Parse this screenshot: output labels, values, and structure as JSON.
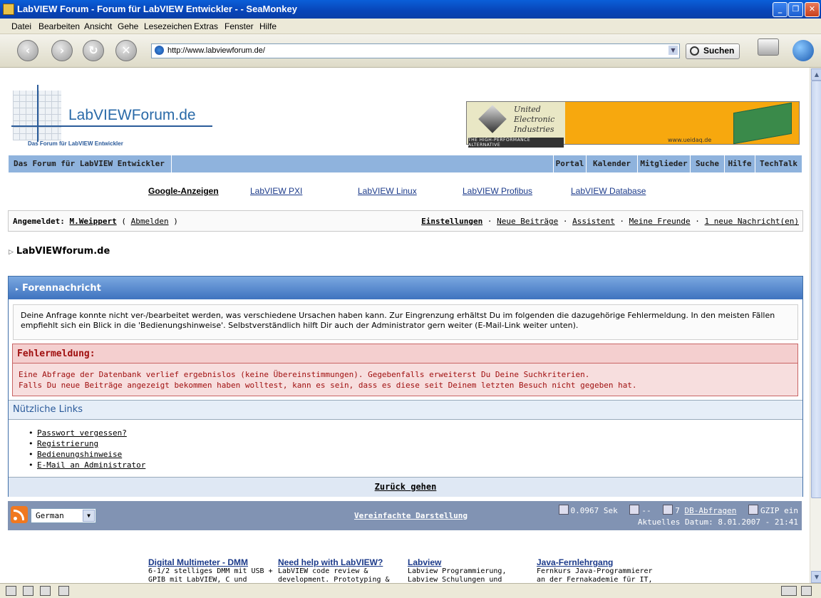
{
  "window": {
    "title": "LabVIEW Forum - Forum für LabVIEW Entwickler - - SeaMonkey"
  },
  "menu": [
    "Datei",
    "Bearbeiten",
    "Ansicht",
    "Gehe",
    "Lesezeichen",
    "Extras",
    "Fenster",
    "Hilfe"
  ],
  "toolbar": {
    "url": "http://www.labviewforum.de/",
    "search_label": "Suchen"
  },
  "logo": {
    "text": "LabVIEWForum.de",
    "subtitle": "Das Forum für LabVIEW Entwickler"
  },
  "banner": {
    "brand": "United Electronic Industries",
    "tagline": "THE HIGH-PERFORMANCE ALTERNATIVE",
    "url": "www.ueidaq.de"
  },
  "navbar": {
    "brand": "Das Forum für LabVIEW Entwickler",
    "items": [
      "Portal",
      "Kalender",
      "Mitglieder",
      "Suche",
      "Hilfe",
      "TechTalk"
    ]
  },
  "adlinks": [
    "Google-Anzeigen",
    "LabVIEW PXI",
    "LabVIEW Linux",
    "LabVIEW Profibus",
    "LabVIEW Database"
  ],
  "login": {
    "prefix": "Angemeldet:",
    "user": "M.Weippert",
    "logout": "Abmelden",
    "links": [
      "Einstellungen",
      "Neue Beiträge",
      "Assistent",
      "Meine Freunde",
      "1 neue Nachricht(en)"
    ]
  },
  "breadcrumb": "LabVIEWforum.de",
  "main": {
    "title": "Forennachricht",
    "message": "Deine Anfrage konnte nicht ver-/bearbeitet werden, was verschiedene Ursachen haben kann. Zur Eingrenzung erhältst Du im folgenden die dazugehörige Fehlermeldung. In den meisten Fällen empfiehlt sich ein Blick in die 'Bedienungshinweise'. Selbstverständlich hilft Dir auch der Administrator gern weiter (E-Mail-Link weiter unten).",
    "error_title": "Fehlermeldung:",
    "error_line1": "Eine Abfrage der Datenbank verlief ergebnislos (keine Übereinstimmungen). Gegebenfalls erweiterst Du Deine Suchkriterien.",
    "error_line2": "Falls Du neue Beiträge angezeigt bekommen haben wolltest, kann es sein, dass es diese seit Deinem letzten Besuch nicht gegeben hat.",
    "links_title": "Nützliche Links",
    "links": [
      "Passwort vergessen?",
      "Registrierung",
      "Bedienungshinweise",
      "E-Mail an Administrator"
    ],
    "back": "Zurück gehen"
  },
  "footer": {
    "language": "German",
    "simple": "Vereinfachte Darstellung",
    "time": "0.0967 Sek",
    "load": "--",
    "queries_count": "7",
    "queries_label": "DB-Abfragen",
    "gzip": "GZIP ein",
    "date": "Aktuelles Datum: 8.01.2007 - 21:41"
  },
  "ads": [
    {
      "title": "Digital Multimeter - DMM",
      "desc": "6-1/2 stelliges DMM mit USB + GPIB mit LabVIEW, C und"
    },
    {
      "title": "Need help with LabVIEW?",
      "desc": "LabVIEW code review & development. Prototyping &"
    },
    {
      "title": "Labview",
      "desc": "Labview Programmierung, Labview Schulungen und"
    },
    {
      "title": "Java-Fernlehrgang",
      "desc": "Fernkurs Java-Programmierer an der Fernakademie für IT,"
    }
  ]
}
